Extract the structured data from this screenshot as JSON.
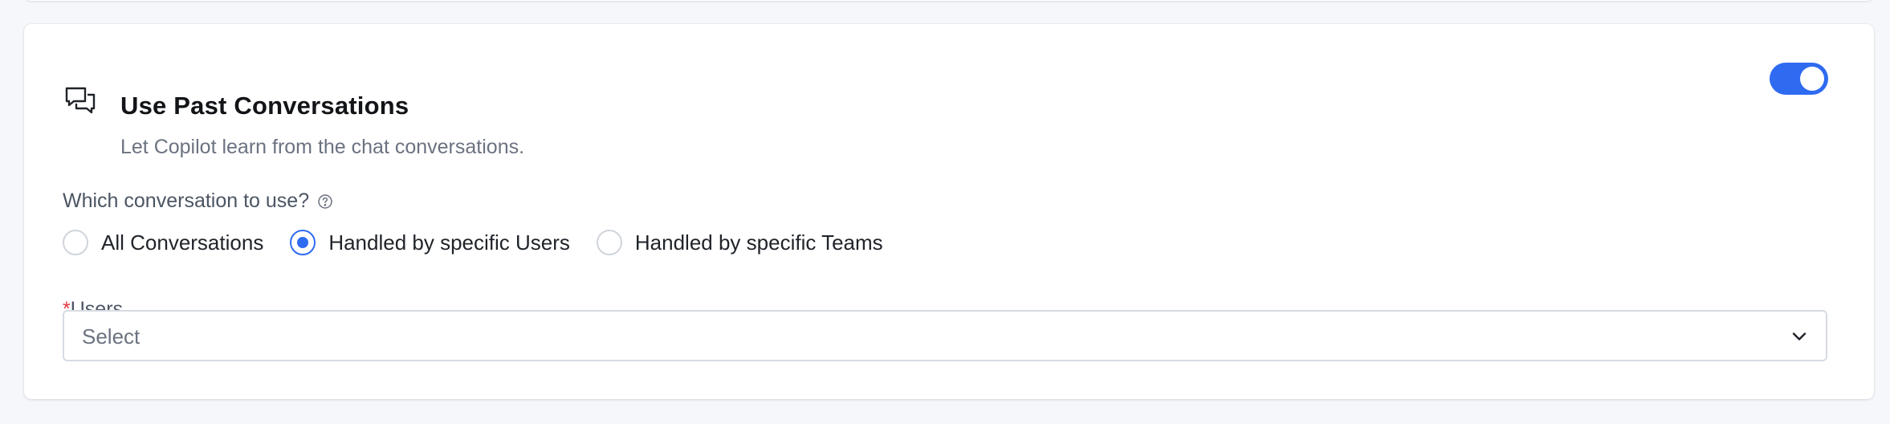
{
  "section": {
    "title": "Use Past Conversations",
    "subtitle": "Let Copilot learn from the chat conversations.",
    "toggle_enabled": true,
    "accent_color": "#2f6bf1",
    "icon": "chat-bubbles-icon"
  },
  "conversation_source": {
    "question": "Which conversation to use?",
    "help_icon": "question-circle-icon",
    "options": [
      {
        "label": "All Conversations",
        "checked": false
      },
      {
        "label": "Handled by specific Users",
        "checked": true
      },
      {
        "label": "Handled by specific Teams",
        "checked": false
      }
    ]
  },
  "users_field": {
    "required_marker": "*",
    "label": "Users",
    "placeholder": "Select",
    "icon": "chevron-down-icon"
  }
}
